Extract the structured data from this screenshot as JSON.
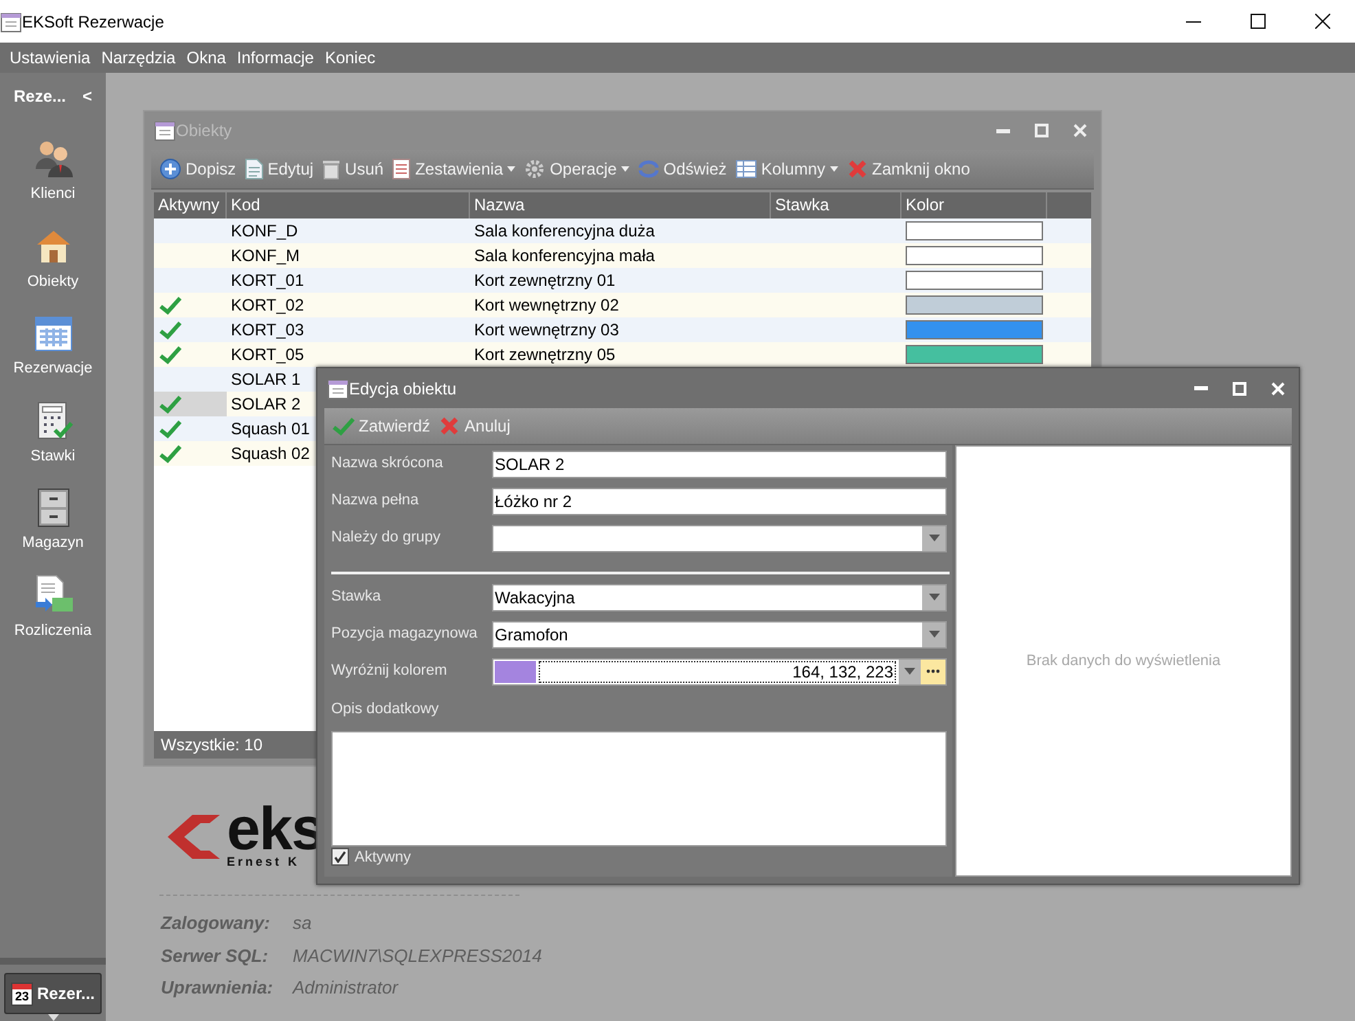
{
  "window": {
    "title": "EKSoft Rezerwacje"
  },
  "menu": [
    "Ustawienia",
    "Narzędzia",
    "Okna",
    "Informacje",
    "Koniec"
  ],
  "sidebar": {
    "header": "Reze...",
    "collapse": "<",
    "items": [
      {
        "label": "Klienci",
        "kind": "people"
      },
      {
        "label": "Obiekty",
        "kind": "house"
      },
      {
        "label": "Rezerwacje",
        "kind": "calendar"
      },
      {
        "label": "Stawki",
        "kind": "calculator"
      },
      {
        "label": "Magazyn",
        "kind": "cabinet"
      },
      {
        "label": "Rozliczenia",
        "kind": "invoice"
      }
    ],
    "bottom_button": {
      "label": "Rezer...",
      "calendar_day": "23"
    }
  },
  "objects_window": {
    "title": "Obiekty",
    "toolbar": [
      {
        "label": "Dopisz",
        "kind": "add",
        "dropdown": false
      },
      {
        "label": "Edytuj",
        "kind": "edit",
        "dropdown": false
      },
      {
        "label": "Usuń",
        "kind": "delete",
        "dropdown": false
      },
      {
        "label": "Zestawienia",
        "kind": "report",
        "dropdown": true
      },
      {
        "label": "Operacje",
        "kind": "gear",
        "dropdown": true
      },
      {
        "label": "Odśwież",
        "kind": "refresh",
        "dropdown": false
      },
      {
        "label": "Kolumny",
        "kind": "columns",
        "dropdown": true
      },
      {
        "label": "Zamknij okno",
        "kind": "close",
        "dropdown": false
      }
    ],
    "table": {
      "columns": [
        "Aktywny",
        "Kod",
        "Nazwa",
        "Stawka",
        "Kolor"
      ],
      "rows": [
        {
          "active": false,
          "kod": "KONF_D",
          "nazwa": "Sala konferencyjna duża",
          "color": "#ffffff",
          "selected": false
        },
        {
          "active": false,
          "kod": "KONF_M",
          "nazwa": "Sala konferencyjna mała",
          "color": "#ffffff",
          "selected": false
        },
        {
          "active": false,
          "kod": "KORT_01",
          "nazwa": "Kort zewnętrzny 01",
          "color": "#ffffff",
          "selected": false
        },
        {
          "active": true,
          "kod": "KORT_02",
          "nazwa": "Kort wewnętrzny 02",
          "color": "#c0cdd8",
          "selected": false
        },
        {
          "active": true,
          "kod": "KORT_03",
          "nazwa": "Kort wewnętrzny 03",
          "color": "#3391ee",
          "selected": false
        },
        {
          "active": true,
          "kod": "KORT_05",
          "nazwa": "Kort zewnętrzny 05",
          "color": "#45bf9f",
          "selected": false
        },
        {
          "active": false,
          "kod": "SOLAR 1",
          "selected": false
        },
        {
          "active": true,
          "kod": "SOLAR 2",
          "selected": true
        },
        {
          "active": true,
          "kod": "Squash 01",
          "selected": false
        },
        {
          "active": true,
          "kod": "Squash 02",
          "selected": false
        }
      ]
    },
    "footer": "Wszystkie: 10"
  },
  "logo": {
    "mark": "eks",
    "subtitle": "Ernest K"
  },
  "login_info": [
    {
      "label": "Zalogowany:",
      "value": "sa"
    },
    {
      "label": "Serwer SQL:",
      "value": "MACWIN7\\SQLEXPRESS2014"
    },
    {
      "label": "Uprawnienia:",
      "value": "Administrator"
    }
  ],
  "edit_dialog": {
    "title": "Edycja obiektu",
    "toolbar": [
      {
        "label": "Zatwierdź",
        "kind": "confirm"
      },
      {
        "label": "Anuluj",
        "kind": "cancel"
      }
    ],
    "fields": [
      {
        "kind": "text",
        "label": "Nazwa skrócona",
        "value": "SOLAR 2"
      },
      {
        "kind": "text",
        "label": "Nazwa pełna",
        "value": "Łóżko nr 2"
      },
      {
        "kind": "combo",
        "label": "Należy do grupy"
      },
      {
        "kind": "separator"
      },
      {
        "kind": "combo",
        "label": "Stawka",
        "value": "Wakacyjna"
      },
      {
        "kind": "combo",
        "label": "Pozycja magazynowa",
        "value": "Gramofon"
      },
      {
        "kind": "color",
        "label": "Wyróżnij kolorem",
        "value": "164, 132, 223",
        "color": "#a484df"
      },
      {
        "kind": "memo",
        "label": "Opis dodatkowy"
      }
    ],
    "checkbox": {
      "label": "Aktywny",
      "checked": true
    },
    "side_panel": {
      "message": "Brak danych do wyświetlenia"
    }
  }
}
